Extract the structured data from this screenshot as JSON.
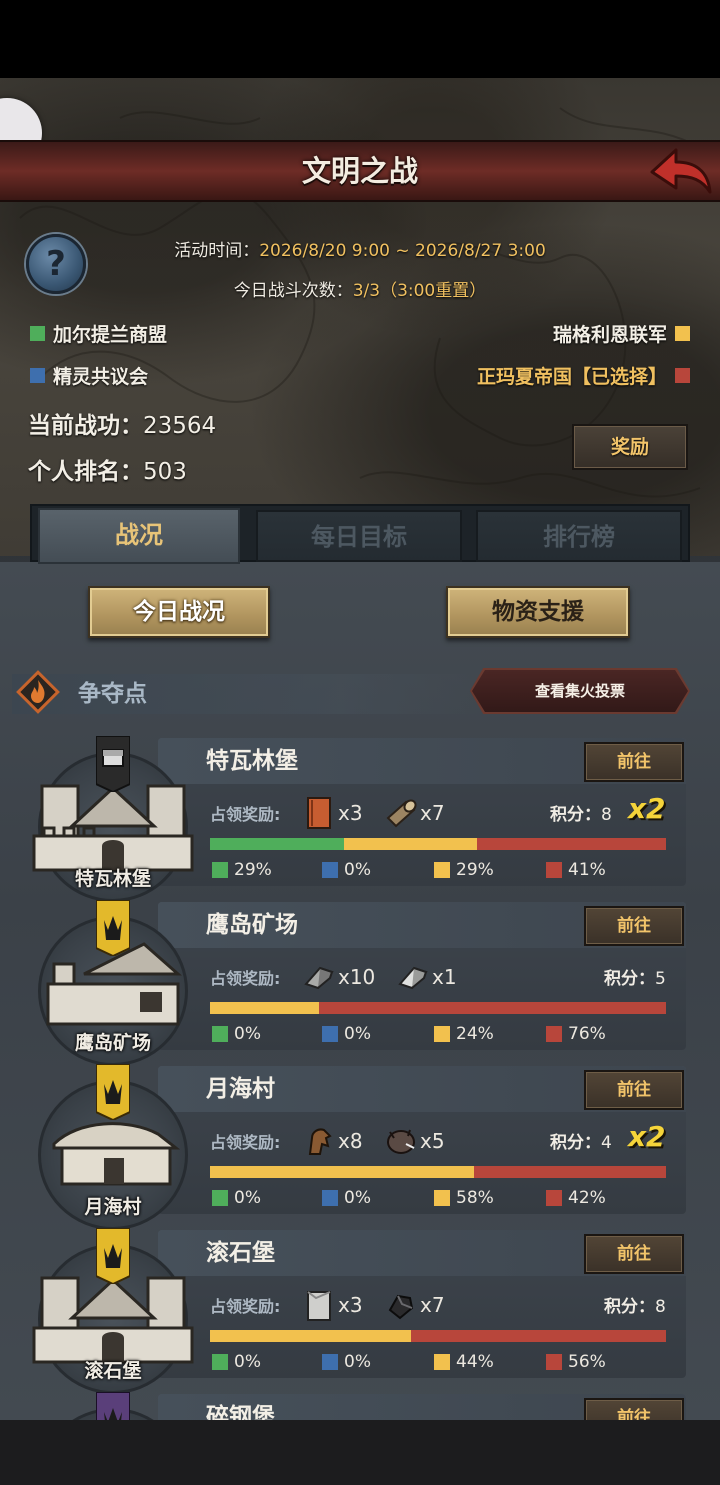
{
  "header": {
    "title": "文明之战"
  },
  "event": {
    "time_label": "活动时间：",
    "time_value": "2026/8/20 9:00 ~ 2026/8/27 3:00",
    "battles_label": "今日战斗次数：",
    "battles_value": "3/3（3:00重置）"
  },
  "factions": [
    {
      "name": "加尔提兰商盟",
      "color": "#4fae5b"
    },
    {
      "name": "精灵共议会",
      "color": "#3e6fae"
    },
    {
      "name": "瑞格利恩联军",
      "color": "#f2c14e"
    },
    {
      "name": "正玛夏帝国【已选择】",
      "color": "#b8463b"
    }
  ],
  "stats": {
    "merit_label": "当前战功：",
    "merit_value": "23564",
    "rank_label": "个人排名：",
    "rank_value": "503"
  },
  "reward_button": "奖励",
  "tabs": [
    "战况",
    "每日目标",
    "排行榜"
  ],
  "subtabs": {
    "today": "今日战况",
    "supply": "物资支援"
  },
  "section": {
    "title": "争夺点",
    "vote_button": "查看集火投票"
  },
  "card_labels": {
    "reward": "占领奖励:",
    "score": "积分：",
    "goto": "前往"
  },
  "points": [
    {
      "name": "特瓦林堡",
      "banner": "chest-banner",
      "score": "8",
      "bonus": "x2",
      "rewards": [
        {
          "icon": "book-icon",
          "qty": "x3"
        },
        {
          "icon": "wood-log-icon",
          "qty": "x7"
        }
      ],
      "shares": [
        29,
        0,
        29,
        41
      ],
      "share_labels": [
        "29%",
        "0%",
        "29%",
        "41%"
      ]
    },
    {
      "name": "鹰岛矿场",
      "banner": "crown-banner",
      "score": "5",
      "bonus": "",
      "rewards": [
        {
          "icon": "iron-ingot-icon",
          "qty": "x10"
        },
        {
          "icon": "silver-ingot-icon",
          "qty": "x1"
        }
      ],
      "shares": [
        0,
        0,
        24,
        76
      ],
      "share_labels": [
        "0%",
        "0%",
        "24%",
        "76%"
      ]
    },
    {
      "name": "月海村",
      "banner": "crown-banner",
      "score": "4",
      "bonus": "x2",
      "rewards": [
        {
          "icon": "horse-icon",
          "qty": "x8"
        },
        {
          "icon": "boar-icon",
          "qty": "x5"
        }
      ],
      "shares": [
        0,
        0,
        58,
        42
      ],
      "share_labels": [
        "0%",
        "0%",
        "58%",
        "42%"
      ]
    },
    {
      "name": "滚石堡",
      "banner": "crown-banner",
      "score": "8",
      "bonus": "",
      "rewards": [
        {
          "icon": "stone-block-icon",
          "qty": "x3"
        },
        {
          "icon": "coal-icon",
          "qty": "x7"
        }
      ],
      "shares": [
        0,
        0,
        44,
        56
      ],
      "share_labels": [
        "0%",
        "0%",
        "44%",
        "56%"
      ]
    },
    {
      "name": "碎钢堡",
      "banner": "dark-banner"
    }
  ]
}
